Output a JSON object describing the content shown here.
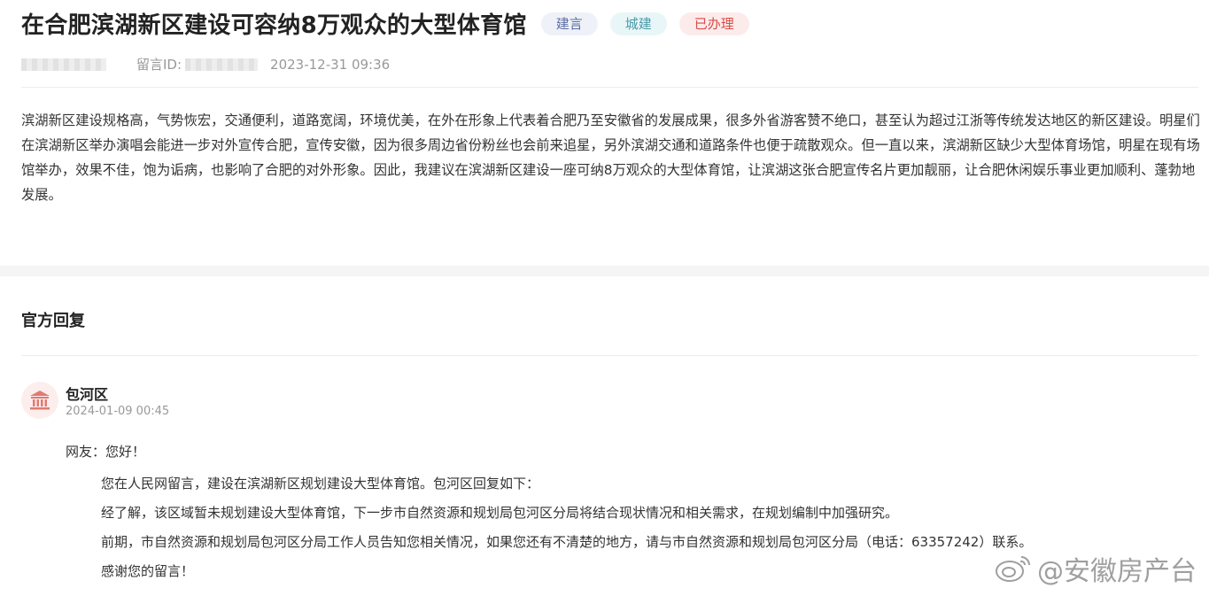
{
  "message": {
    "title": "在合肥滨湖新区建设可容纳8万观众的大型体育馆",
    "tags": [
      {
        "label": "建言",
        "color": "#5b6ea5"
      },
      {
        "label": "城建",
        "color": "#4a9aa8"
      },
      {
        "label": "已办理",
        "color": "#d94c48"
      }
    ],
    "id_label": "留言ID:",
    "date": "2023-12-31 09:36",
    "body": "滨湖新区建设规格高，气势恢宏，交通便利，道路宽阔，环境优美，在外在形象上代表着合肥乃至安徽省的发展成果，很多外省游客赞不绝口，甚至认为超过江浙等传统发达地区的新区建设。明星们在滨湖新区举办演唱会能进一步对外宣传合肥，宣传安徽，因为很多周边省份粉丝也会前来追星，另外滨湖交通和道路条件也便于疏散观众。但一直以来，滨湖新区缺少大型体育场馆，明星在现有场馆举办，效果不佳，饱为诟病，也影响了合肥的对外形象。因此，我建议在滨湖新区建设一座可纳8万观众的大型体育馆，让滨湖这张合肥宣传名片更加靓丽，让合肥休闲娱乐事业更加顺利、蓬勃地发展。"
  },
  "reply": {
    "heading": "官方回复",
    "org_name": "包河区",
    "org_icon": "government-building-icon",
    "date": "2024-01-09 00:45",
    "greeting": "网友：您好！",
    "paragraphs": [
      "您在人民网留言，建设在滨湖新区规划建设大型体育馆。包河区回复如下：",
      "经了解，该区域暂未规划建设大型体育馆，下一步市自然资源和规划局包河区分局将结合现状情况和相关需求，在规划编制中加强研究。",
      "前期，市自然资源和规划局包河区分局工作人员告知您相关情况，如果您还有不清楚的地方，请与市自然资源和规划局包河区分局（电话：63357242）联系。",
      "感谢您的留言！"
    ]
  },
  "watermark": {
    "text": "@安徽房产台",
    "icon": "weibo-icon"
  }
}
